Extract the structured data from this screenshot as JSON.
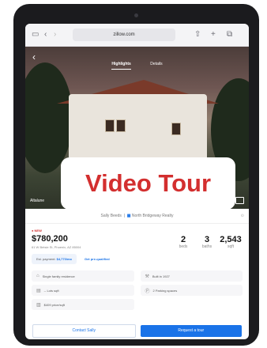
{
  "browser": {
    "url": "zillow.com",
    "icons": [
      "sidebar-icon",
      "back-icon",
      "forward-icon",
      "share-icon",
      "new-tab-icon",
      "tabs-icon"
    ]
  },
  "photo_tabs": [
    "Highlights",
    "Details"
  ],
  "photo_overlay": "Video Tour",
  "photo_credit": "Altalune",
  "listed_by": {
    "prefix": "Sally Beeds",
    "brokerage": "North Bridgeway Realty"
  },
  "listing": {
    "badge": "NEW",
    "price": "$780,200",
    "address": "61 W Betsie St, Phoenix, AZ 85004",
    "beds": "2",
    "beds_label": "beds",
    "baths": "3",
    "baths_label": "baths",
    "sqft": "2,543",
    "sqft_label": "sqft"
  },
  "payment": {
    "label": "Est. payment:",
    "value": "$4,770/mo",
    "prequal": "Get pre-qualified"
  },
  "facts": [
    {
      "icon": "home-icon",
      "text": "Single family residence"
    },
    {
      "icon": "hammer-icon",
      "text": "Built in 1927"
    },
    {
      "icon": "ruler-icon",
      "text": "-- Lots sqft"
    },
    {
      "icon": "parking-icon",
      "text": "2 Parking spaces"
    },
    {
      "icon": "price-icon",
      "text": "$409 price/sqft"
    }
  ],
  "actions": {
    "contact": "Contact Sally",
    "tour": "Request a tour"
  }
}
